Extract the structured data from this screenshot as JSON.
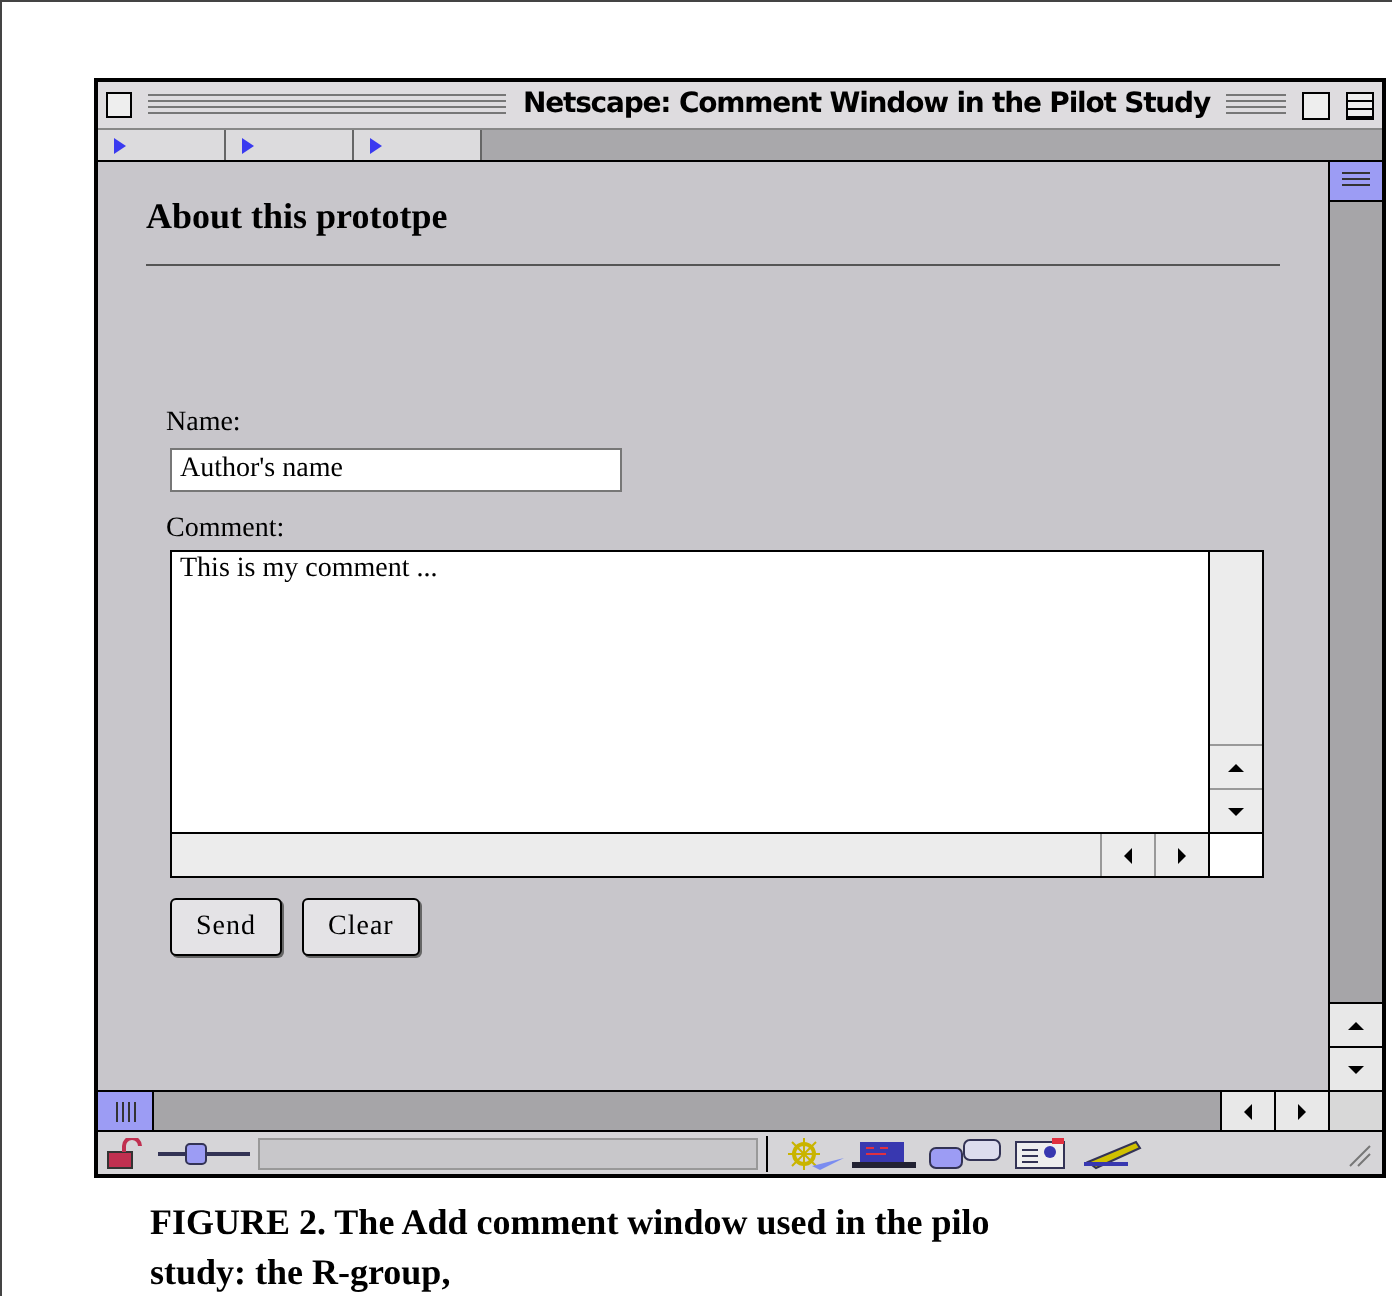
{
  "window": {
    "title": "Netscape: Comment Window in the Pilot Study"
  },
  "page": {
    "heading": "About this prototpe",
    "name_label": "Name:",
    "name_value": "Author's name",
    "comment_label": "Comment:",
    "comment_value": "This is my comment ...",
    "buttons": [
      "Send",
      "Clear"
    ]
  },
  "caption": [
    "FIGURE 2. The Add comment window used in the pilo",
    "study: the R-group,"
  ]
}
